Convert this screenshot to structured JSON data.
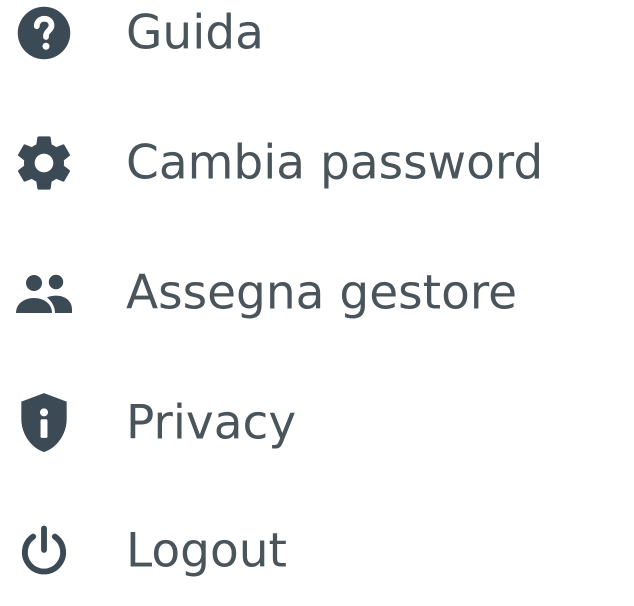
{
  "menu": {
    "items": [
      {
        "label": "Guida",
        "icon": "help-circle-icon"
      },
      {
        "label": "Cambia password",
        "icon": "gear-icon"
      },
      {
        "label": "Assegna gestore",
        "icon": "people-icon"
      },
      {
        "label": "Privacy",
        "icon": "shield-info-icon"
      },
      {
        "label": "Logout",
        "icon": "power-icon"
      }
    ]
  },
  "colors": {
    "icon": "#3c4a55",
    "text": "#4a545b",
    "background": "#ffffff"
  }
}
